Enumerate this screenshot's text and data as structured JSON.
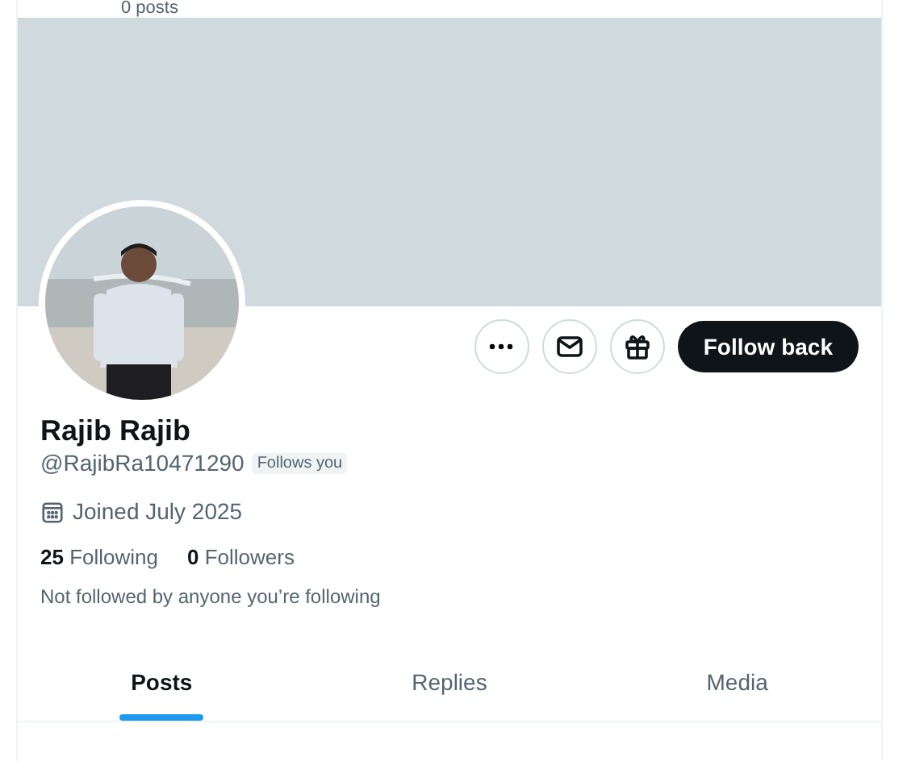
{
  "header": {
    "post_count": "0 posts"
  },
  "actions": [
    {
      "kind": "more"
    },
    {
      "kind": "message"
    },
    {
      "kind": "gift"
    },
    {
      "kind": "follow",
      "label": "Follow back"
    }
  ],
  "profile": {
    "name": "Rajib Rajib",
    "handle": "@RajibRa10471290",
    "badge": "Follows you",
    "joined": "Joined July 2025",
    "stats": [
      {
        "count": "25",
        "label": "Following"
      },
      {
        "count": "0",
        "label": "Followers"
      }
    ],
    "mutuals": "Not followed by anyone you’re following"
  },
  "tabs": [
    {
      "label": "Posts",
      "selected": true
    },
    {
      "label": "Replies",
      "selected": false
    },
    {
      "label": "Media",
      "selected": false
    }
  ]
}
